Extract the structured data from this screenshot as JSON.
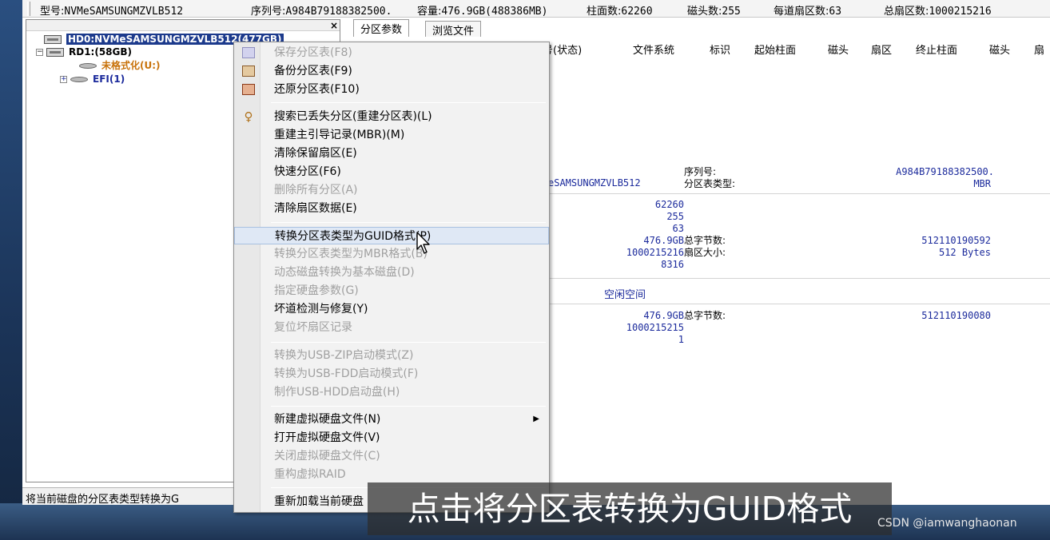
{
  "infobar": {
    "model_label": "型号:",
    "model_value": "NVMeSAMSUNGMZVLB512",
    "serial_label": "序列号:",
    "serial_value": "A984B79188382500.",
    "capacity_label": "容量:",
    "capacity_value": "476.9GB(488386MB)",
    "cyl_label": "柱面数:",
    "cyl_value": "62260",
    "heads_label": "磁头数:",
    "heads_value": "255",
    "spt_label": "每道扇区数:",
    "spt_value": "63",
    "total_sectors_label": "总扇区数:",
    "total_sectors_value": "1000215216"
  },
  "tree": {
    "close_glyph": "×",
    "hd0": "HD0:NVMeSAMSUNGMZVLB512(477GB)",
    "rd1": "RD1:(58GB)",
    "unformatted": "未格式化(U:)",
    "efi": "EFI(1)",
    "expand_minus": "−",
    "expand_plus": "+"
  },
  "statusbar": {
    "text": "将当前磁盘的分区表类型转换为G"
  },
  "tabs": [
    {
      "label": "分区参数"
    },
    {
      "label": "浏览文件"
    }
  ],
  "columns": {
    "seq_status": "序号(状态)",
    "filesystem": "文件系统",
    "flag": "标识",
    "start_cyl": "起始柱面",
    "head1": "磁头",
    "sector1": "扇区",
    "end_cyl": "终止柱面",
    "head2": "磁头",
    "sector2": "扇"
  },
  "details": {
    "model_partial": "eSAMSUNGMZVLB512",
    "serial_label": "序列号:",
    "serial_value": "A984B79188382500.",
    "pt_type_label": "分区表类型:",
    "pt_type_value": "MBR",
    "cylinders": "62260",
    "heads": "255",
    "spt": "63",
    "capacity": "476.9GB",
    "total_bytes_label": "总字节数:",
    "total_bytes_value": "512110190592",
    "total_sectors": "1000215216",
    "sector_size_label": "扇区大小:",
    "sector_size_value": "512 Bytes",
    "extra": "8316",
    "free_space_label": "空闲空间",
    "free_capacity": "476.9GB",
    "free_total_bytes_label": "总字节数:",
    "free_total_bytes_value": "512110190080",
    "free_sectors": "1000215215",
    "free_start": "1"
  },
  "menu": {
    "items": [
      {
        "label": "保存分区表(F8)",
        "disabled": true
      },
      {
        "label": "备份分区表(F9)",
        "disabled": false
      },
      {
        "label": "还原分区表(F10)",
        "disabled": false
      },
      {
        "label": "搜索已丢失分区(重建分区表)(L)",
        "disabled": false
      },
      {
        "label": "重建主引导记录(MBR)(M)",
        "disabled": false
      },
      {
        "label": "清除保留扇区(E)",
        "disabled": false
      },
      {
        "label": "快速分区(F6)",
        "disabled": false
      },
      {
        "label": "删除所有分区(A)",
        "disabled": true
      },
      {
        "label": "清除扇区数据(E)",
        "disabled": false
      },
      {
        "label": "转换分区表类型为GUID格式(P)",
        "disabled": false
      },
      {
        "label": "转换分区表类型为MBR格式(B)",
        "disabled": true
      },
      {
        "label": "动态磁盘转换为基本磁盘(D)",
        "disabled": true
      },
      {
        "label": "指定硬盘参数(G)",
        "disabled": true
      },
      {
        "label": "坏道检测与修复(Y)",
        "disabled": false
      },
      {
        "label": "复位坏扇区记录",
        "disabled": true
      },
      {
        "label": "转换为USB-ZIP启动模式(Z)",
        "disabled": true
      },
      {
        "label": "转换为USB-FDD启动模式(F)",
        "disabled": true
      },
      {
        "label": "制作USB-HDD启动盘(H)",
        "disabled": true
      },
      {
        "label": "新建虚拟硬盘文件(N)",
        "disabled": false
      },
      {
        "label": "打开虚拟硬盘文件(V)",
        "disabled": false
      },
      {
        "label": "关闭虚拟硬盘文件(C)",
        "disabled": true
      },
      {
        "label": "重构虚拟RAID",
        "disabled": true
      },
      {
        "label": "重新加载当前硬盘",
        "disabled": false
      }
    ],
    "submenu_arrow": "▶"
  },
  "caption": {
    "text": "点击将分区表转换为GUID格式"
  },
  "watermark": {
    "text": "CSDN @iamwanghaonan"
  },
  "colors": {
    "selection": "#1c3a8c",
    "menu_highlight": "#dfe8f5",
    "disabled_text": "#a0a0a0",
    "accent_blue": "#1c2b9c",
    "accent_orange": "#c8720a"
  }
}
